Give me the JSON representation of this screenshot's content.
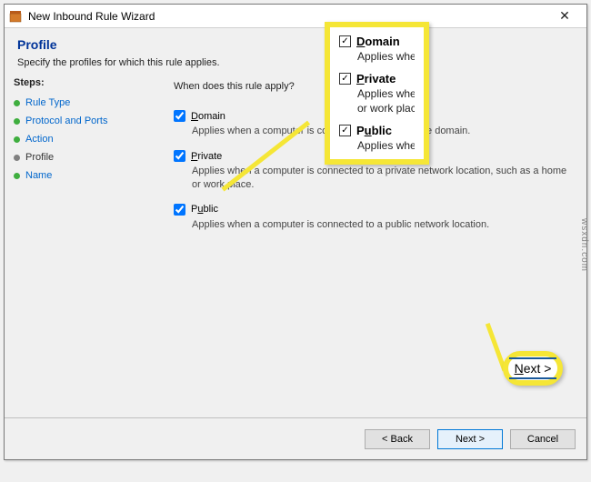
{
  "window": {
    "title": "New Inbound Rule Wizard",
    "close": "✕"
  },
  "header": {
    "title": "Profile",
    "subtitle": "Specify the profiles for which this rule applies."
  },
  "sidebar": {
    "label": "Steps:",
    "items": [
      {
        "label": "Rule Type",
        "current": false
      },
      {
        "label": "Protocol and Ports",
        "current": false
      },
      {
        "label": "Action",
        "current": false
      },
      {
        "label": "Profile",
        "current": true
      },
      {
        "label": "Name",
        "current": false
      }
    ]
  },
  "content": {
    "question": "When does this rule apply?",
    "profiles": [
      {
        "key": "domain",
        "name": "Domain",
        "letter": "D",
        "checked": true,
        "desc": "Applies when a computer is connected to its corporate domain."
      },
      {
        "key": "private",
        "name": "Private",
        "letter": "P",
        "checked": true,
        "desc": "Applies when a computer is connected to a private network location, such as a home or work place."
      },
      {
        "key": "public",
        "name": "Public",
        "letter": "u",
        "checked": true,
        "desc": "Applies when a computer is connected to a public network location."
      }
    ]
  },
  "footer": {
    "back": "< Back",
    "next": "Next >",
    "cancel": "Cancel"
  },
  "callouts": {
    "profiles": [
      {
        "name": "Domain",
        "letter": "D",
        "desc": "Applies when"
      },
      {
        "name": "Private",
        "letter": "P",
        "desc_line1": "Applies when",
        "desc_line2": "or work place"
      },
      {
        "name": "Public",
        "letter": "u",
        "desc": "Applies when"
      }
    ],
    "next": "Next >",
    "check": "✓"
  },
  "watermark": "wsxdn.com"
}
